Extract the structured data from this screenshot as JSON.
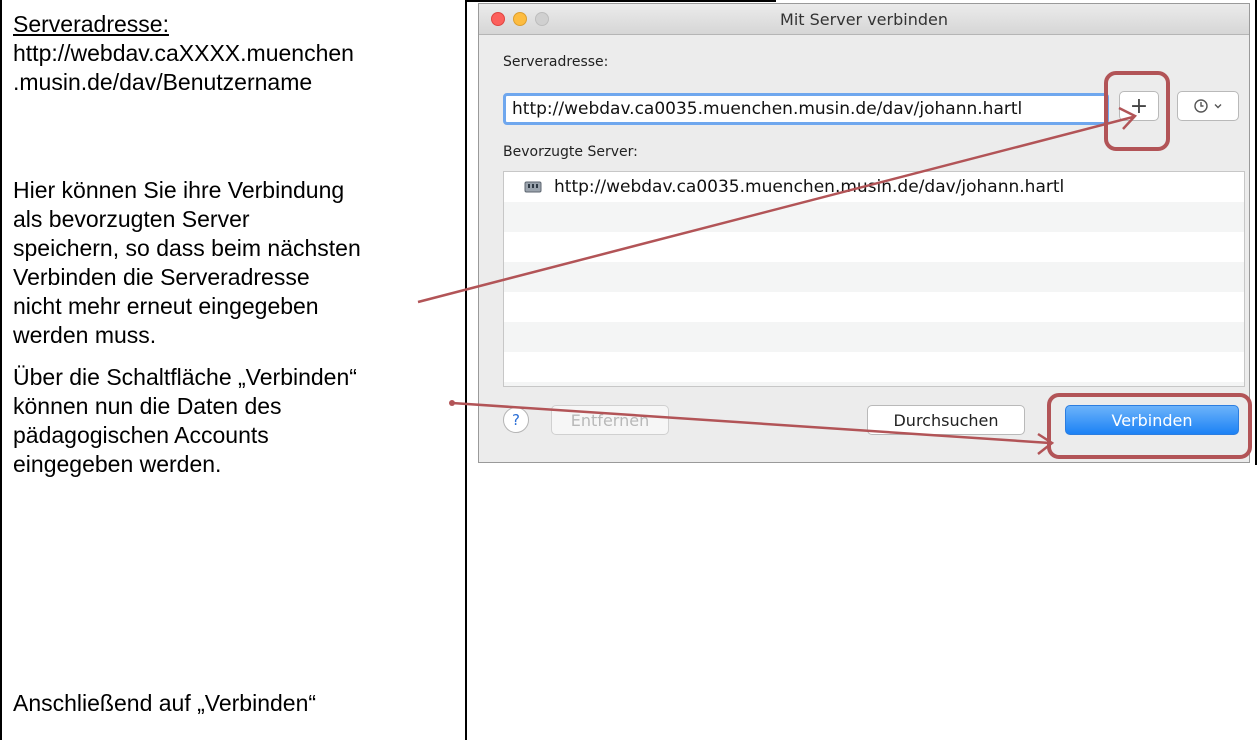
{
  "document": {
    "server_heading": "Serveradresse:",
    "address_line1": "http://webdav.caXXXX.muenchen",
    "address_line2": ".musin.de/dav/Benutzername",
    "save_text": [
      "Hier können Sie ihre Verbindung",
      "als bevorzugten Server",
      "speichern, so dass beim nächsten",
      "Verbinden die Serveradresse",
      "nicht mehr erneut eingegeben",
      "werden muss."
    ],
    "connect_text": [
      "Über die Schaltfläche „Verbinden“",
      "können nun die Daten des",
      "pädagogischen Accounts",
      "eingegeben werden."
    ],
    "final_text": "Anschließend auf „Verbinden“"
  },
  "dialog": {
    "title": "Mit Server verbinden",
    "address_label": "Serveradresse:",
    "address_value": "http://webdav.ca0035.muenchen.musin.de/dav/johann.hartl",
    "add_button": "+",
    "recent_icon": "clock-icon",
    "favorites_label": "Bevorzugte Server:",
    "favorites": [
      "http://webdav.ca0035.muenchen.musin.de/dav/johann.hartl"
    ],
    "help_button": "?",
    "remove_button": "Entfernen",
    "browse_button": "Durchsuchen",
    "connect_button": "Verbinden"
  },
  "colors": {
    "annotation": "#b25457",
    "accent": "#1c82f5"
  }
}
